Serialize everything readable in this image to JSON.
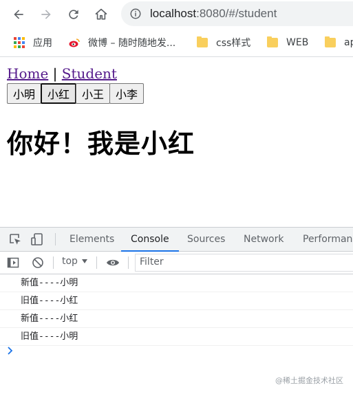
{
  "browser": {
    "url_host": "localhost",
    "url_rest": ":8080/#/student"
  },
  "bookmarks": [
    {
      "label": "应用",
      "icon": "apps-grid-icon"
    },
    {
      "label": "微博 – 随时随地发...",
      "icon": "weibo-icon"
    },
    {
      "label": "css样式",
      "icon": "folder-icon"
    },
    {
      "label": "WEB",
      "icon": "folder-icon"
    },
    {
      "label": "ap",
      "icon": "folder-icon"
    }
  ],
  "page": {
    "nav": {
      "home": "Home",
      "sep": "|",
      "student": "Student"
    },
    "buttons": [
      "小明",
      "小红",
      "小王",
      "小李"
    ],
    "active_button": "小红",
    "greeting": "你好！我是小红"
  },
  "devtools": {
    "tabs": [
      "Elements",
      "Console",
      "Sources",
      "Network",
      "Performanc"
    ],
    "active_tab": "Console",
    "context": "top",
    "filter_placeholder": "Filter",
    "logs": [
      "新值----小明",
      "旧值----小红",
      "新值----小红",
      "旧值----小明"
    ],
    "accent_color": "#1a73e8"
  },
  "watermark": "@稀土掘金技术社区"
}
